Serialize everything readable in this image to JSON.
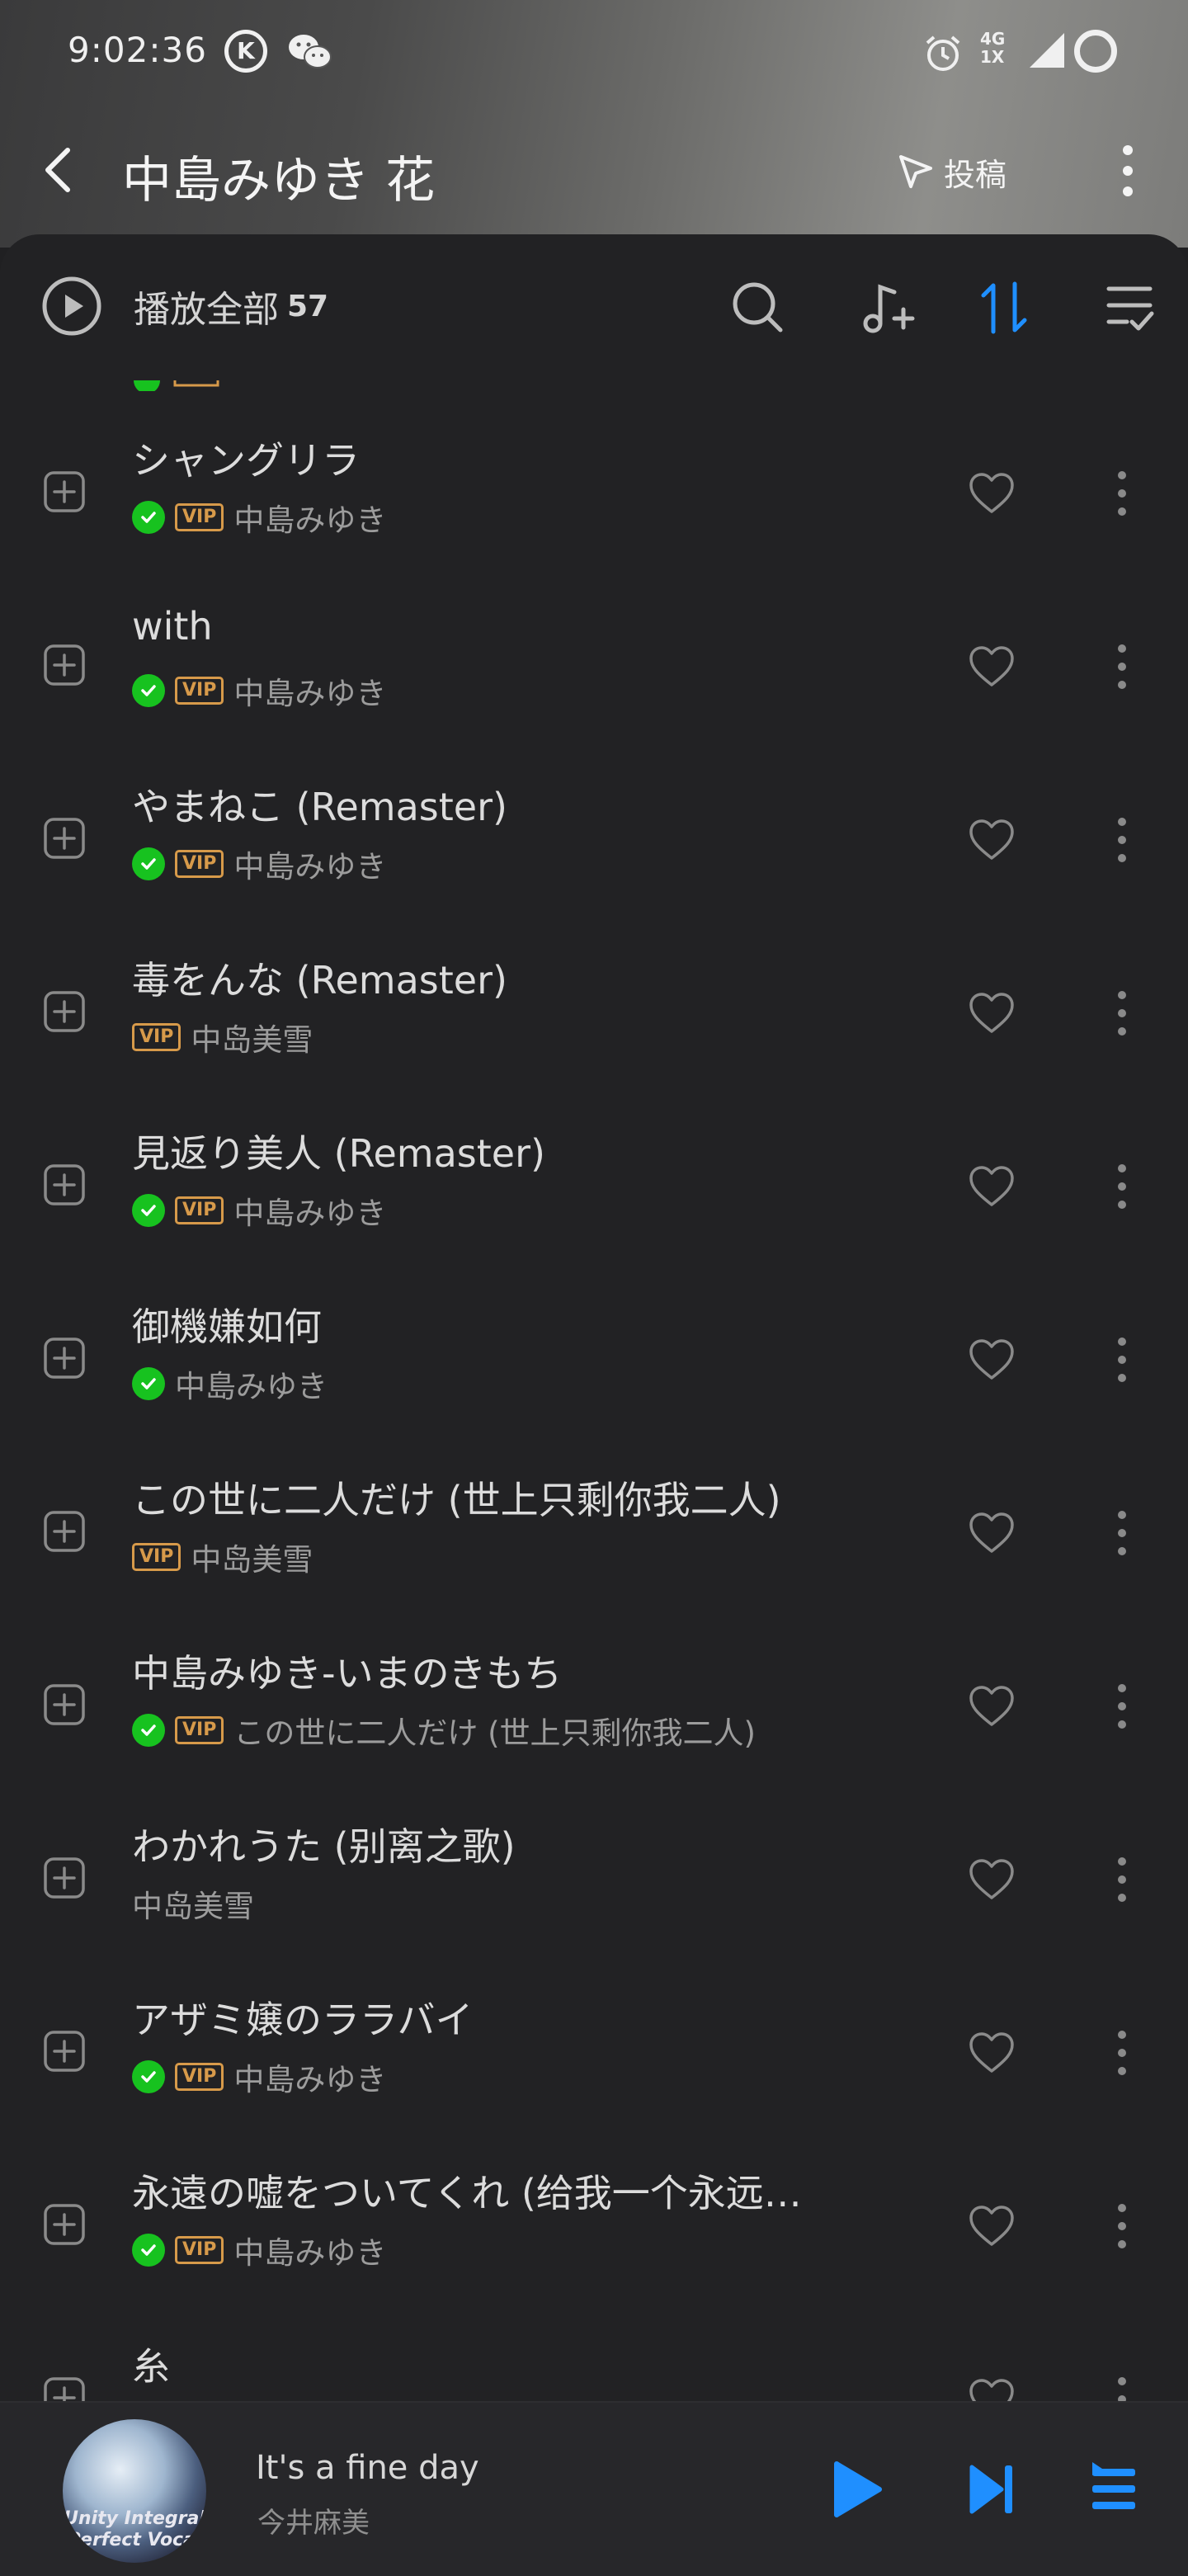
{
  "status_bar": {
    "time": "9:02:36",
    "network": "4G",
    "network_sub": "1X"
  },
  "header": {
    "title": "中島みゆき 花",
    "submit_label": "投稿"
  },
  "toolbar": {
    "play_all_label": "播放全部",
    "count": "57"
  },
  "songs": [
    {
      "title": "シャングリラ",
      "verified": true,
      "vip": true,
      "artist": "中島みゆき"
    },
    {
      "title": "with",
      "verified": true,
      "vip": true,
      "artist": "中島みゆき"
    },
    {
      "title": "やまねこ (Remaster)",
      "verified": true,
      "vip": true,
      "artist": "中島みゆき"
    },
    {
      "title": "毒をんな (Remaster)",
      "verified": false,
      "vip": true,
      "artist": "中岛美雪"
    },
    {
      "title": "見返り美人 (Remaster)",
      "verified": true,
      "vip": true,
      "artist": "中島みゆき"
    },
    {
      "title": "御機嫌如何",
      "verified": true,
      "vip": false,
      "artist": "中島みゆき"
    },
    {
      "title": "この世に二人だけ (世上只剩你我二人)",
      "verified": false,
      "vip": true,
      "artist": "中岛美雪"
    },
    {
      "title": "中島みゆき-いまのきもち",
      "verified": true,
      "vip": true,
      "artist": "この世に二人だけ (世上只剩你我二人)"
    },
    {
      "title": "わかれうた (别离之歌)",
      "verified": false,
      "vip": false,
      "artist": "中岛美雪"
    },
    {
      "title": "アザミ嬢のララバイ",
      "verified": true,
      "vip": true,
      "artist": "中島みゆき"
    },
    {
      "title": "永遠の嘘をついてくれ (给我一个永远…",
      "verified": true,
      "vip": true,
      "artist": "中島みゆき"
    },
    {
      "title": "糸",
      "verified": false,
      "vip": false,
      "artist": ""
    }
  ],
  "vip_label": "VIP",
  "now_playing": {
    "title": "It's a fine day",
    "artist": "今井麻美",
    "cover_text": "Unity Integral\nPerfect Vocal"
  },
  "colors": {
    "accent": "#1f8fff",
    "verified": "#17c21f",
    "vip": "#d79a4a",
    "background": "#222224"
  }
}
